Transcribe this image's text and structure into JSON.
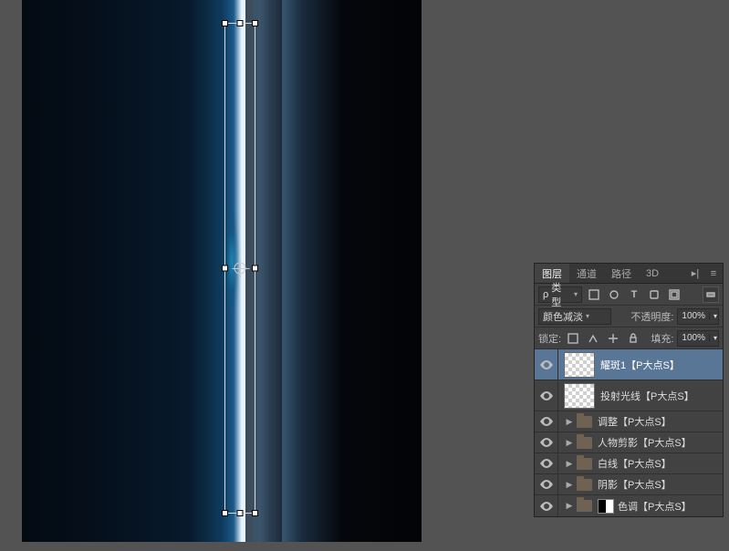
{
  "canvas": {
    "has_transform_box": true
  },
  "panel": {
    "tabs": [
      "图层",
      "通道",
      "路径",
      "3D"
    ],
    "active_tab": 0,
    "menu_glyph": "▸|",
    "filter_row": {
      "kind_label": "类型",
      "kind_icon": "ρ",
      "filter_icons": [
        "image",
        "adj",
        "text",
        "shape",
        "smart"
      ],
      "toggle_on": true
    },
    "blend_row": {
      "mode": "颜色减淡",
      "opacity_label": "不透明度:",
      "opacity_value": "100%"
    },
    "lock_row": {
      "lock_label": "锁定:",
      "lock_icons": [
        "image",
        "pos",
        "brush",
        "move",
        "all"
      ],
      "fill_label": "填充:",
      "fill_value": "100%"
    }
  },
  "layers": [
    {
      "type": "pixel",
      "visible": true,
      "selected": true,
      "name": "耀斑1【P大点S】",
      "thumb": "checker"
    },
    {
      "type": "pixel",
      "visible": true,
      "selected": false,
      "name": "投射光线【P大点S】",
      "thumb": "checker"
    },
    {
      "type": "group",
      "visible": true,
      "selected": false,
      "name": "调整【P大点S】"
    },
    {
      "type": "group",
      "visible": true,
      "selected": false,
      "name": "人物剪影【P大点S】"
    },
    {
      "type": "group",
      "visible": true,
      "selected": false,
      "name": "白线【P大点S】"
    },
    {
      "type": "group",
      "visible": true,
      "selected": false,
      "name": "阴影【P大点S】"
    },
    {
      "type": "group",
      "visible": true,
      "selected": false,
      "name": "色调【P大点S】",
      "has_adj": true
    }
  ]
}
